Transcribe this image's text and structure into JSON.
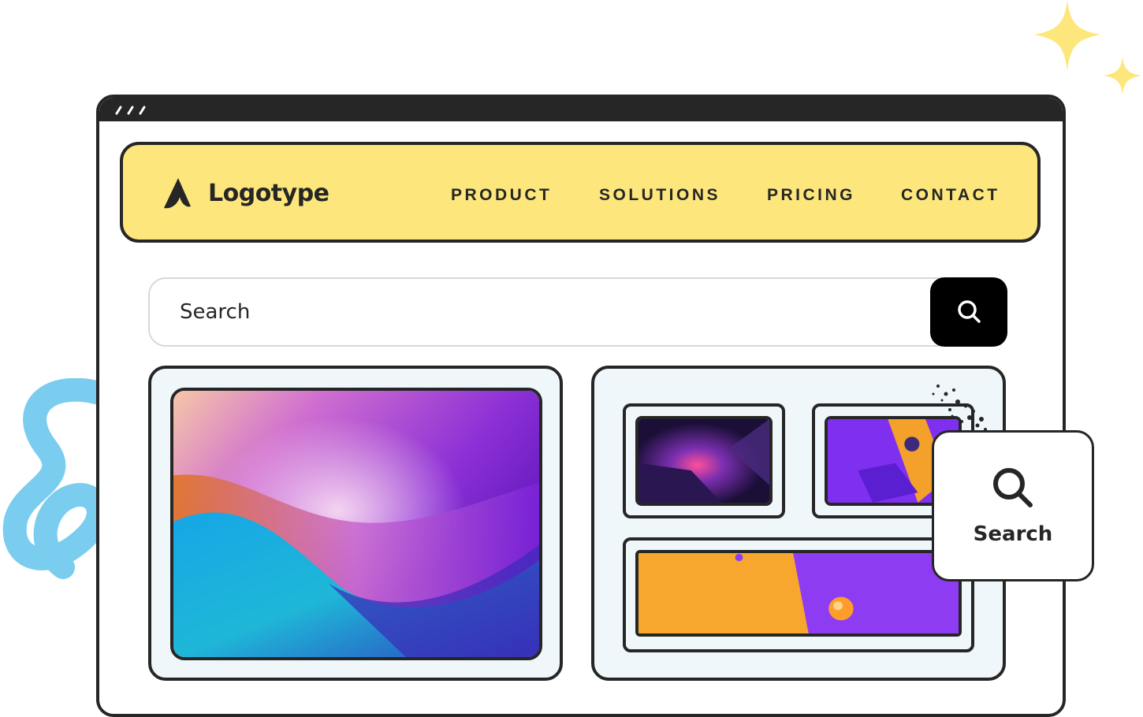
{
  "brand": {
    "name": "Logotype"
  },
  "nav": {
    "items": [
      {
        "label": "PRODUCT"
      },
      {
        "label": "SOLUTIONS"
      },
      {
        "label": "PRICING"
      },
      {
        "label": "CONTACT"
      }
    ]
  },
  "search": {
    "placeholder": "Search",
    "button_icon": "search-icon"
  },
  "tooltip": {
    "label": "Search",
    "icon": "search-icon"
  },
  "colors": {
    "navbar_bg": "#fde77c",
    "outline": "#262626",
    "card_bg": "#f0f7fa",
    "sparkle": "#fde77c",
    "squiggle": "#6cc8ec"
  }
}
